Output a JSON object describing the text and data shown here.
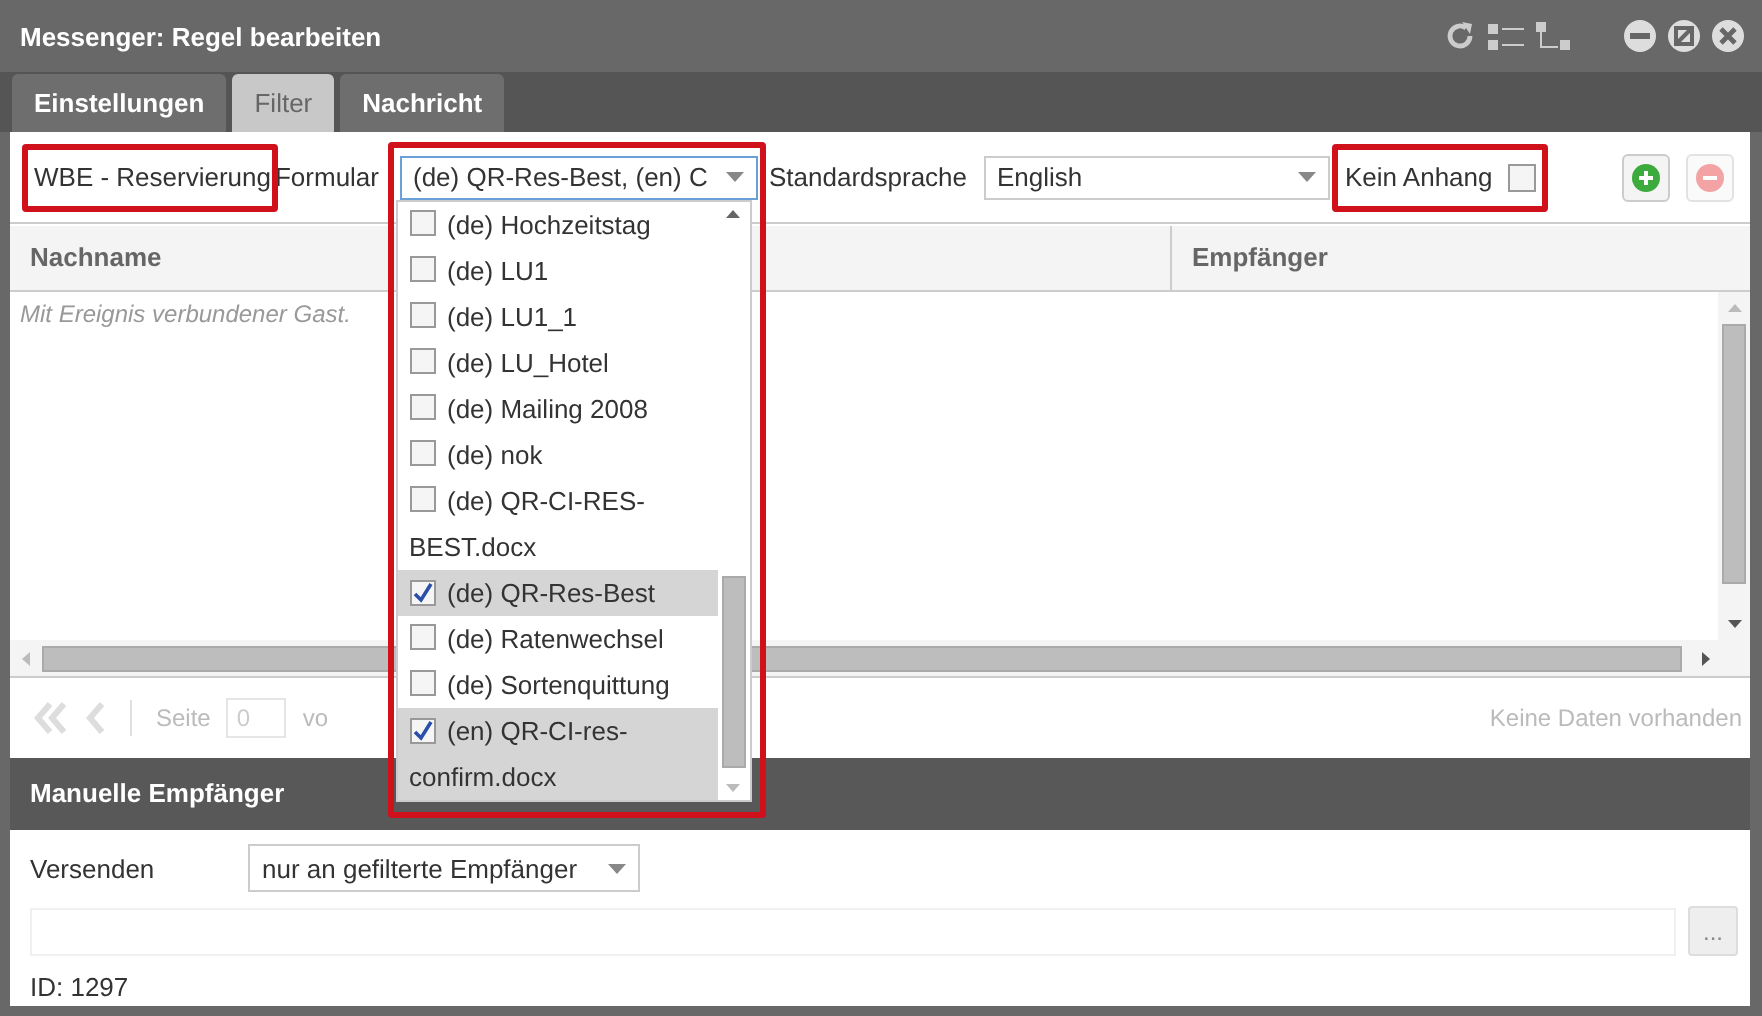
{
  "window": {
    "title": "Messenger: Regel bearbeiten"
  },
  "tabs": [
    {
      "label": "Einstellungen",
      "selected": false
    },
    {
      "label": "Filter",
      "selected": true
    },
    {
      "label": "Nachricht",
      "selected": false
    }
  ],
  "filter_bar": {
    "event": {
      "text": "WBE - Reservierung",
      "highlighted": true
    },
    "form_label": "Formular",
    "form_select": {
      "value": "(de) QR-Res-Best, (en) C",
      "highlighted": true,
      "expanded": true,
      "options": [
        {
          "label": "(de) Hochzeitstag",
          "checked": false
        },
        {
          "label": "(de) LU1",
          "checked": false
        },
        {
          "label": "(de) LU1_1",
          "checked": false
        },
        {
          "label": "(de) LU_Hotel",
          "checked": false
        },
        {
          "label": "(de) Mailing 2008",
          "checked": false
        },
        {
          "label": "(de) nok",
          "checked": false
        },
        {
          "label": "(de) QR-CI-RES-BEST.docx",
          "checked": false
        },
        {
          "label": "(de) QR-Res-Best",
          "checked": true
        },
        {
          "label": "(de) Ratenwechsel",
          "checked": false
        },
        {
          "label": "(de) Sortenquittung",
          "checked": false
        },
        {
          "label": "(en) QR-CI-res-confirm.docx",
          "checked": true
        }
      ]
    },
    "language_label": "Standardsprache",
    "language_select": {
      "value": "English"
    },
    "attachment": {
      "label": "Kein Anhang",
      "checked": false,
      "highlighted": true
    },
    "add_button": {
      "disabled": false
    },
    "remove_button": {
      "disabled": true
    }
  },
  "grid": {
    "columns": [
      "Nachname",
      "Empfänger"
    ],
    "group_row": "Mit Ereignis verbundener Gast."
  },
  "pager": {
    "page_label": "Seite",
    "page": "0",
    "of_label": "vo",
    "status": "Keine Daten vorhanden"
  },
  "manual": {
    "title": "Manuelle Empfänger",
    "send_label": "Versenden",
    "send_select": "nur an gefilterte Empfänger",
    "more_button": "...",
    "id": "ID: 1297"
  }
}
